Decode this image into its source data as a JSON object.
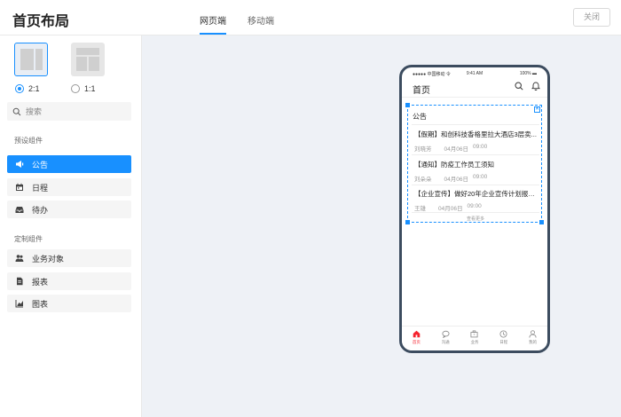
{
  "header": {
    "title": "首页布局",
    "tabs": [
      {
        "label": "网页端",
        "active": true
      },
      {
        "label": "移动端",
        "active": false
      }
    ],
    "close_label": "关闭"
  },
  "sidebar": {
    "layout_options": [
      {
        "label": "2:1",
        "selected": true
      },
      {
        "label": "1:1",
        "selected": false
      }
    ],
    "search_placeholder": "搜索",
    "preset_section": "预设组件",
    "preset_items": [
      {
        "label": "公告",
        "icon": "megaphone-icon",
        "active": true
      },
      {
        "label": "日程",
        "icon": "calendar-icon",
        "active": false
      },
      {
        "label": "待办",
        "icon": "inbox-icon",
        "active": false
      }
    ],
    "custom_section": "定制组件",
    "custom_items": [
      {
        "label": "业务对象",
        "icon": "users-icon"
      },
      {
        "label": "报表",
        "icon": "document-icon"
      },
      {
        "label": "图表",
        "icon": "chart-icon"
      }
    ]
  },
  "phone": {
    "status_left": "●●●●● 中国移动 令",
    "status_time": "9:41 AM",
    "status_right": "100% ▬",
    "app_title": "首页",
    "widget": {
      "title": "公告",
      "notices": [
        {
          "title": "【假期】和创科技香格里拉大酒店3层卖...",
          "author": "刘晓芳",
          "date": "04月06日",
          "time": "09:00"
        },
        {
          "title": "【通知】防疫工作员工须知",
          "author": "刘朵朵",
          "date": "04月06日",
          "time": "09:00"
        },
        {
          "title": "【企业宣传】做好20年企业宣传计划报告会",
          "author": "王雄",
          "date": "04月06日",
          "time": "09:00"
        }
      ],
      "more_label": "查看更多"
    },
    "tabbar": [
      {
        "label": "首页",
        "icon": "home-icon",
        "active": true
      },
      {
        "label": "沟通",
        "icon": "chat-icon",
        "active": false
      },
      {
        "label": "业务",
        "icon": "briefcase-icon",
        "active": false
      },
      {
        "label": "日程",
        "icon": "clock-icon",
        "active": false
      },
      {
        "label": "我的",
        "icon": "user-icon",
        "active": false
      }
    ]
  },
  "colors": {
    "accent": "#1890ff",
    "canvas_bg": "#eef1f6",
    "phone_frame": "#3c4c5f",
    "tab_active": "#f5222d"
  }
}
